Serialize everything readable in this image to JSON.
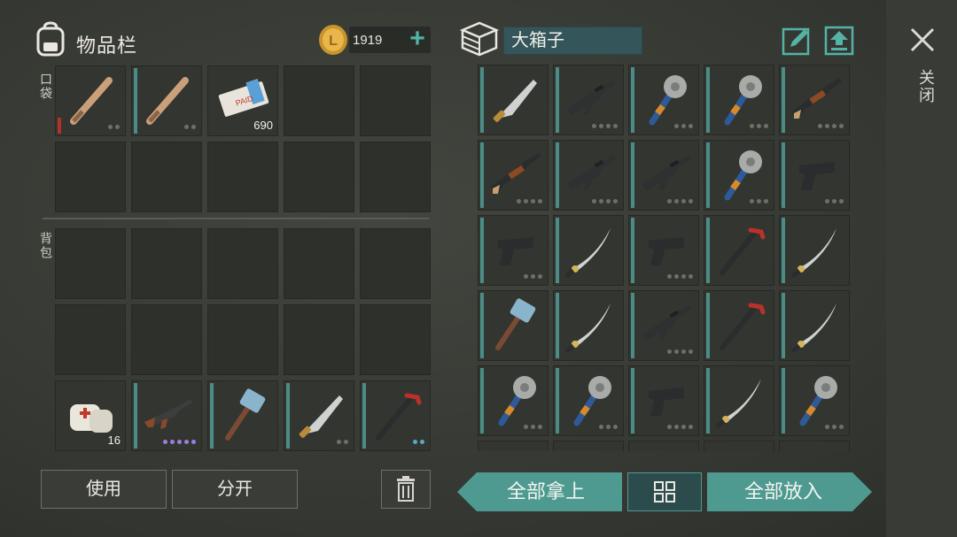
{
  "inventory": {
    "title": "物品栏",
    "pocket_label": "口袋",
    "backpack_label": "背包",
    "coins": "1919",
    "add_symbol": "+"
  },
  "container": {
    "name": "大箱子"
  },
  "actions": {
    "use": "使用",
    "split": "分开",
    "take_all": "全部拿上",
    "put_all": "全部放入",
    "close": "关闭"
  },
  "pocket_slots": [
    {
      "item": "baseball-bat",
      "bar": "red",
      "dots": 2
    },
    {
      "item": "baseball-bat",
      "bar": "teal",
      "dots": 2
    },
    {
      "item": "ticket",
      "qty": "690"
    },
    {},
    {},
    {},
    {},
    {},
    {},
    {}
  ],
  "backpack_slots": [
    {},
    {},
    {},
    {},
    {},
    {},
    {},
    {},
    {},
    {},
    {
      "item": "bandage",
      "qty": "16"
    },
    {
      "item": "ak47",
      "bar": "teal",
      "dots": 5,
      "dot_color": "purple"
    },
    {
      "item": "sledgehammer",
      "bar": "teal"
    },
    {
      "item": "machete",
      "bar": "teal",
      "dots": 2
    },
    {
      "item": "crowbar",
      "bar": "teal",
      "dots": 2,
      "dot_color": "blue"
    }
  ],
  "container_slots": [
    {
      "item": "machete",
      "bar": "teal"
    },
    {
      "item": "rifle",
      "bar": "teal",
      "dots": 4
    },
    {
      "item": "saw-club",
      "bar": "teal",
      "dots": 3
    },
    {
      "item": "saw-club",
      "bar": "teal",
      "dots": 3
    },
    {
      "item": "shotgun",
      "bar": "teal",
      "dots": 4
    },
    {
      "item": "shotgun",
      "bar": "teal",
      "dots": 4
    },
    {
      "item": "rifle",
      "bar": "teal",
      "dots": 4
    },
    {
      "item": "rifle",
      "bar": "teal",
      "dots": 4
    },
    {
      "item": "saw-club",
      "bar": "teal",
      "dots": 3
    },
    {
      "item": "pistol",
      "bar": "teal",
      "dots": 3
    },
    {
      "item": "pistol",
      "bar": "teal",
      "dots": 3
    },
    {
      "item": "katana",
      "bar": "teal"
    },
    {
      "item": "pistol",
      "bar": "teal",
      "dots": 4
    },
    {
      "item": "crowbar",
      "bar": "teal"
    },
    {
      "item": "katana",
      "bar": "teal"
    },
    {
      "item": "sledgehammer",
      "bar": "teal"
    },
    {
      "item": "katana",
      "bar": "teal"
    },
    {
      "item": "rifle",
      "bar": "teal",
      "dots": 4
    },
    {
      "item": "crowbar",
      "bar": "teal"
    },
    {
      "item": "katana",
      "bar": "teal"
    },
    {
      "item": "saw-club",
      "bar": "teal",
      "dots": 3
    },
    {
      "item": "saw-club",
      "bar": "teal",
      "dots": 3
    },
    {
      "item": "pistol",
      "bar": "teal",
      "dots": 4
    },
    {
      "item": "katana",
      "bar": "teal"
    },
    {
      "item": "saw-club",
      "bar": "teal",
      "dots": 3
    },
    {
      "item": "partial"
    },
    {
      "item": "partial"
    },
    {
      "item": "partial"
    },
    {
      "item": "partial"
    },
    {
      "item": "partial"
    }
  ]
}
